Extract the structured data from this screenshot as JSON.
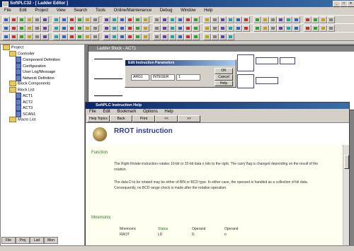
{
  "app": {
    "title": "SoftPLC32 - [ Ladder Editor ]",
    "menu": [
      "File",
      "Edit",
      "Project",
      "View",
      "Search",
      "Tools",
      "Online/Maintenance",
      "Debug",
      "Window",
      "Help"
    ]
  },
  "tree": {
    "items": [
      {
        "label": "Project",
        "kind": "folder",
        "indent": 0
      },
      {
        "label": "Controller",
        "kind": "folder",
        "indent": 1
      },
      {
        "label": "Component Definition",
        "kind": "doc",
        "indent": 2
      },
      {
        "label": "Configuration",
        "kind": "doc",
        "indent": 2
      },
      {
        "label": "User Log/Message",
        "kind": "doc",
        "indent": 2
      },
      {
        "label": "Network Definition",
        "kind": "doc",
        "indent": 2
      },
      {
        "label": "Block Components",
        "kind": "folder",
        "indent": 1
      },
      {
        "label": "Block List",
        "kind": "folder",
        "indent": 1
      },
      {
        "label": "ACT1",
        "kind": "doc",
        "indent": 2
      },
      {
        "label": "ACT2",
        "kind": "doc",
        "indent": 2
      },
      {
        "label": "ACT3",
        "kind": "doc",
        "indent": 2
      },
      {
        "label": "SCAN1",
        "kind": "doc",
        "indent": 2
      },
      {
        "label": "Macro List",
        "kind": "folder",
        "indent": 1
      }
    ],
    "tabs": [
      "File",
      "Proj",
      "Lad",
      "Mon"
    ]
  },
  "ladder": {
    "title": "Ladder Block - ACT1"
  },
  "dialog": {
    "title": "Edit Instruction Parameters",
    "field1": "ARG1",
    "field2": "INTEGER",
    "field3": "1",
    "ok": "OK",
    "cancel": "Cancel",
    "help": "Help"
  },
  "help": {
    "window_title": "SoftPLC Instruction Help",
    "menu": [
      "File",
      "Edit",
      "Bookmark",
      "Options",
      "Help"
    ],
    "buttons": [
      "Help Topics",
      "Back",
      "Print",
      "<<",
      ">>"
    ],
    "heading": "RROT instruction",
    "function_label": "Function",
    "function_p1": "The Right Rotate instruction rotates 16-bit or 32-bit data n bits to the right. The carry flag is changed depending on the result of the rotation.",
    "function_p2": "The data D to be rotated may be either of BIN or BCD type. In either case, the operand is handled as a collection of bit data. Consequently, no BCD range check is made after the rotation operation.",
    "mnemonic_label": "Mnemonic",
    "table_headers": [
      "Mnemonic",
      "Status",
      "Operand",
      "Operand"
    ],
    "table_row": [
      "RROT",
      "LD",
      "D",
      "n"
    ]
  }
}
